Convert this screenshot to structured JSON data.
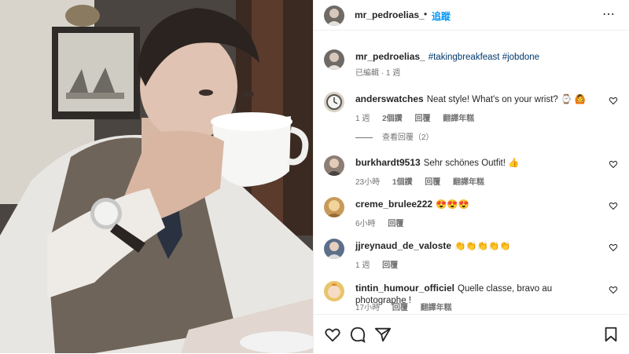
{
  "post": {
    "author": "mr_pedroelias_",
    "dot": "•",
    "follow_label": "追蹤",
    "more_label": "⋯",
    "caption_tags": "#takingbreakfeast #jobdone",
    "caption_meta": "已編輯 · 1 週"
  },
  "comments": [
    {
      "user": "anderswatches",
      "text": "Neat style! What's on your wrist? ⌚ 🙆",
      "time": "1 週",
      "likes": "2個讚",
      "reply": "回覆",
      "translate": "翻譯年糕",
      "avatar_color": "#d9d2c4",
      "avatar_icon": "watch-avatar"
    },
    {
      "user": "burkhardt9513",
      "text": "Sehr schönes Outfit! 👍",
      "time": "23小時",
      "likes": "1個讚",
      "reply": "回覆",
      "translate": "翻譯年糕",
      "avatar_color": "#8c7e74",
      "avatar_icon": "person-avatar"
    },
    {
      "user": "creme_brulee222",
      "text": "😍😍😍",
      "time": "6小時",
      "reply": "回覆",
      "avatar_color": "#c79a5a",
      "avatar_icon": "person-avatar"
    },
    {
      "user": "jjreynaud_de_valoste",
      "text": "👏👏👏👏👏",
      "time": "1 週",
      "reply": "回覆",
      "avatar_color": "#5b6f8a",
      "avatar_icon": "person-avatar"
    },
    {
      "user": "tintin_humour_officiel",
      "text": "Quelle classe, bravo au photographe !",
      "time": "17小時",
      "reply": "回覆",
      "translate": "翻譯年糕",
      "avatar_color": "#e9c46a",
      "avatar_icon": "cartoon-avatar"
    }
  ],
  "view_replies": "查看回覆（2）",
  "colors": {
    "accent": "#0095f6",
    "text": "#262626",
    "muted": "#737373",
    "border": "#efefef"
  }
}
